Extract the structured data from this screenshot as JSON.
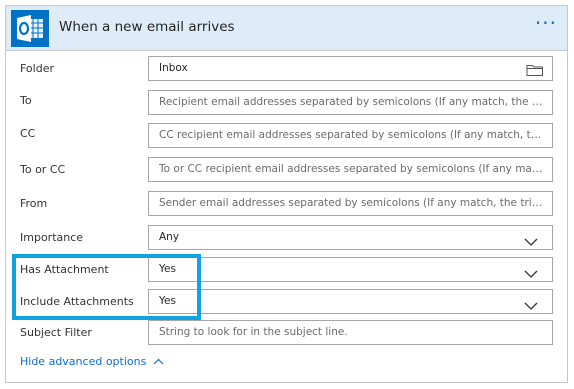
{
  "header": {
    "title": "When a new email arrives",
    "more_label": "···",
    "icon": "outlook-icon"
  },
  "fields": [
    {
      "label": "Folder",
      "value": "Inbox",
      "placeholder": "",
      "kind": "folder-picker"
    },
    {
      "label": "To",
      "value": "",
      "placeholder": "Recipient email addresses separated by semicolons (If any match, the trigger ...",
      "kind": "text"
    },
    {
      "label": "CC",
      "value": "",
      "placeholder": "CC recipient email addresses separated by semicolons (If any match, the trigg...",
      "kind": "text"
    },
    {
      "label": "To or CC",
      "value": "",
      "placeholder": "To or CC recipient email addresses separated by semicolons (If any match, th...",
      "kind": "text"
    },
    {
      "label": "From",
      "value": "",
      "placeholder": "Sender email addresses separated by semicolons (If any match, the trigger wi...",
      "kind": "text"
    },
    {
      "label": "Importance",
      "value": "Any",
      "placeholder": "",
      "kind": "dropdown"
    },
    {
      "label": "Has Attachment",
      "value": "Yes",
      "placeholder": "",
      "kind": "dropdown"
    },
    {
      "label": "Include Attachments",
      "value": "Yes",
      "placeholder": "",
      "kind": "dropdown"
    },
    {
      "label": "Subject Filter",
      "value": "",
      "placeholder": "String to look for in the subject line.",
      "kind": "text"
    }
  ],
  "footer": {
    "advanced_label": "Hide advanced options"
  },
  "colors": {
    "header_bg": "#deecf9",
    "outlook_blue": "#0072c6",
    "highlight_border": "#10a3e3",
    "link": "#0a6ed1"
  }
}
